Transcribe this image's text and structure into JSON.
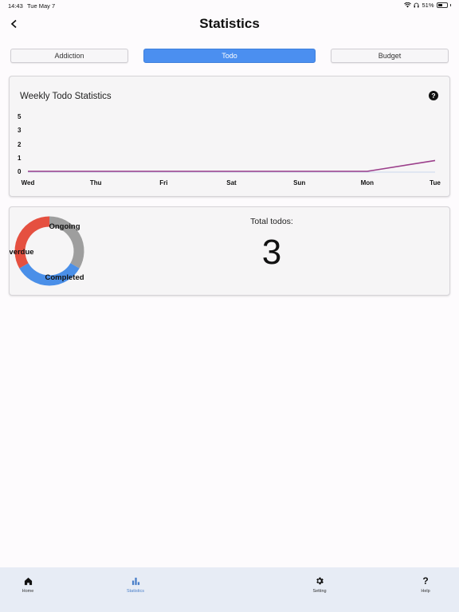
{
  "status_bar": {
    "time": "14:43",
    "date": "Tue May 7",
    "battery": "51%",
    "battery_level": 0.51
  },
  "header": {
    "title": "Statistics"
  },
  "tabs": [
    {
      "label": "Addiction",
      "active": false
    },
    {
      "label": "Todo",
      "active": true
    },
    {
      "label": "Budget",
      "active": false
    }
  ],
  "weekly_card": {
    "title": "Weekly Todo Statistics",
    "help_icon": "question-circle-icon"
  },
  "summary_card": {
    "total_label": "Total todos:",
    "total_value": "3"
  },
  "nav": [
    {
      "label": "Home",
      "icon": "home-icon",
      "selected": false
    },
    {
      "label": "Statistics",
      "icon": "bar-chart-icon",
      "selected": true
    },
    {
      "label": "Setting",
      "icon": "gear-icon",
      "selected": false
    },
    {
      "label": "Help",
      "icon": "question-icon",
      "selected": false
    }
  ],
  "colors": {
    "accent": "#4b8ff0",
    "line": "#9b3f8b",
    "ongoing": "#9e9e9e",
    "overdue": "#e55040",
    "completed": "#4a8fe8",
    "nav_bg": "#e7ecf5"
  },
  "chart_data": [
    {
      "type": "line",
      "title": "Weekly Todo Statistics",
      "categories": [
        "Wed",
        "Thu",
        "Fri",
        "Sat",
        "Sun",
        "Mon",
        "Tue"
      ],
      "series": [
        {
          "values": [
            0,
            0,
            0,
            0,
            0,
            0,
            0.8
          ]
        }
      ],
      "y_ticks": [
        "5",
        "3",
        "2",
        "1",
        "0"
      ],
      "ylim": [
        0,
        5
      ],
      "grid": false,
      "legend": "none"
    },
    {
      "type": "pie",
      "donut": true,
      "labels": [
        "Ongoing",
        "Completed",
        "Overdue"
      ],
      "values": [
        1,
        1,
        1
      ],
      "colors": [
        "#9e9e9e",
        "#4a8fe8",
        "#e55040"
      ]
    }
  ]
}
